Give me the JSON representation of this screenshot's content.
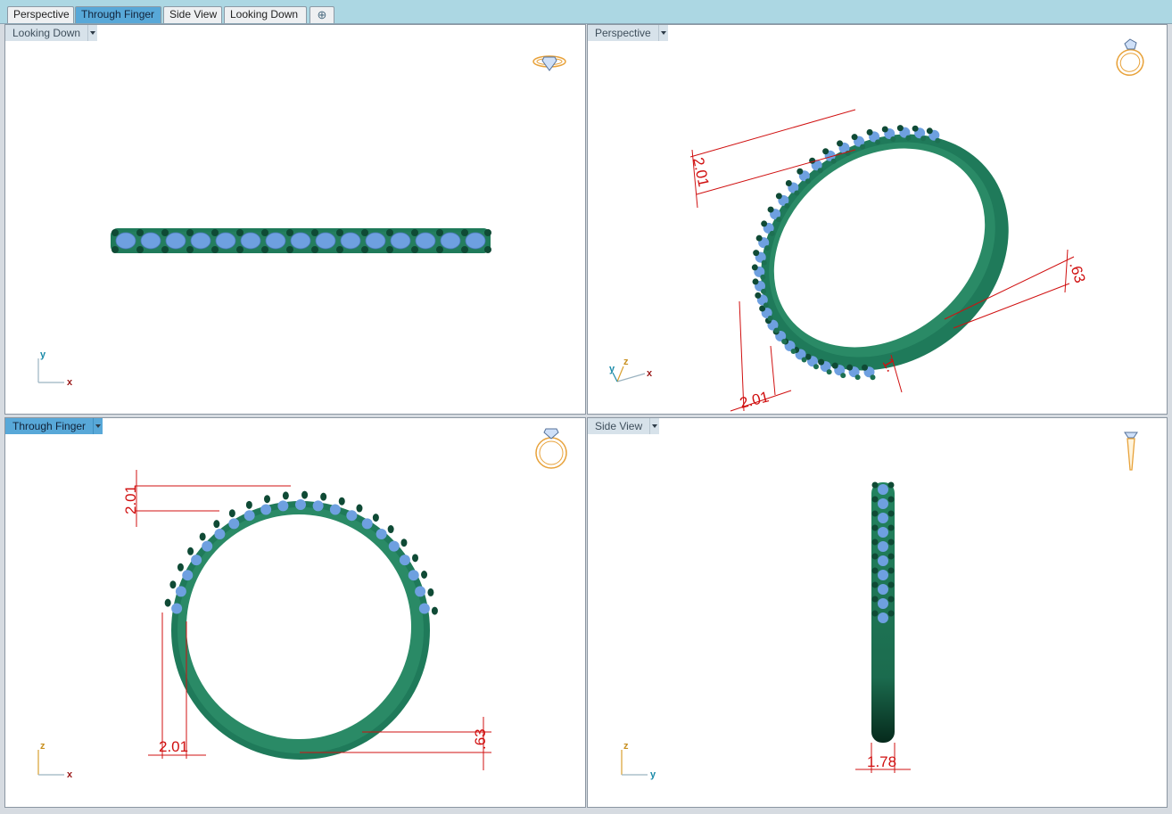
{
  "tabs": [
    {
      "label": "Perspective",
      "active": false
    },
    {
      "label": "Through Finger",
      "active": true
    },
    {
      "label": "Side View",
      "active": false
    },
    {
      "label": "Looking Down",
      "active": false
    }
  ],
  "add_tab_icon": "plus-icon",
  "viewports": {
    "looking_down": {
      "label": "Looking Down",
      "axes": [
        "y",
        "x"
      ],
      "icon": "ring-top-icon"
    },
    "perspective": {
      "label": "Perspective",
      "axes": [
        "y",
        "z",
        "x"
      ],
      "icon": "ring-perspective-icon",
      "dimensions": [
        "2.01",
        "2.01",
        ".63",
        "1."
      ]
    },
    "through_finger": {
      "label": "Through Finger",
      "axes": [
        "z",
        "x"
      ],
      "icon": "ring-front-icon",
      "dimensions": [
        "2.01",
        "2.01",
        ".63"
      ]
    },
    "side_view": {
      "label": "Side View",
      "axes": [
        "z",
        "y"
      ],
      "icon": "ring-side-icon",
      "dimensions": [
        "1.78"
      ]
    }
  },
  "colors": {
    "ring_green": "#1f7a5a",
    "stone_blue": "#6ea0e0",
    "dimension_red": "#d01010",
    "active_tab": "#58a8d8",
    "tab_strip": "#acd7e3"
  }
}
